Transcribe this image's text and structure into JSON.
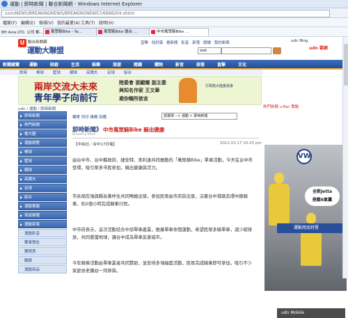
{
  "window": {
    "title": "運動 | 即時新聞 | 聯合新聞網 - Windows Internet Explorer"
  },
  "address": {
    "url": "com/NEWS/BREAKINGNEWS/BREAKINGNEWS7/6968204.shtml"
  },
  "menu": [
    "檔案(F)",
    "編輯(E)",
    "檢視(V)",
    "我的最愛(A)",
    "工具(T)",
    "說明(H)"
  ],
  "favorites": {
    "first": "BH Asia LTD. 公司 郵..."
  },
  "tabs": [
    {
      "label": "萬眾騎Bike - Ya..."
    },
    {
      "label": "萬眾騎Bike 環台 ..."
    },
    {
      "label": "中市萬眾騎Bike ..."
    }
  ],
  "site": {
    "brand_top": "聯合新聞網",
    "brand_main": "運動大聯盟",
    "toplinks": [
      "直擊",
      "找好康",
      "看新聞",
      "影音",
      "部落",
      "閱讀",
      "我的新聞"
    ],
    "right_links": "udn Blog",
    "udn_label": "udn 雲網",
    "search_scope": "web",
    "nav": [
      "新聞總覽",
      "運動",
      "財經",
      "生活",
      "娛樂",
      "旅遊",
      "閱讀",
      "購物",
      "影音",
      "部落",
      "直擊",
      "文化"
    ],
    "subnav": [
      "即時",
      "棒球",
      "籃球",
      "網球",
      "高爾夫",
      "足球",
      "綜合"
    ]
  },
  "banner": {
    "line1": "兩岸交流大未來",
    "line2": "青年學子向前行",
    "line3": "陸委會 張顯耀 副主委",
    "line4": "與知名作家 王文華",
    "line5": "邀你暢所欲言",
    "sponsor": "行政院大陸委員會"
  },
  "breadcrumb": "udn / 運動 / 即時新聞",
  "sidebar": [
    "即時新聞",
    "熱門新聞",
    "看大圖",
    "運動總覽",
    "棒球",
    "籃球",
    "網球",
    "高爾夫",
    "足球",
    "綜合",
    "運動專題",
    "球迷論壇",
    "運動部落",
    "運動影音",
    "賽事預告",
    "賽程表",
    "戰績",
    "運動商品",
    "健身",
    "單車"
  ],
  "article": {
    "tools": "轉寄  列印  推薦  回應",
    "select": "請選擇 --> 運動 > 即時新聞",
    "tag": "即時新聞》",
    "headline": "中市萬眾騎Bike 騎出健康",
    "breaking": "Breaking News",
    "source": "【中央社／台中17日電】",
    "date": "2012.03.17 10:15 pm",
    "paragraphs": [
      "由台中市、台中縣政府、捷安特、美利達共同推動的「萬眾騎Bike」單車活動，今天在台中市登場，吸引眾多市民參加，騎出健康與活力。",
      "市長胡志強與縣長黃仲生共同鳴槍出發，參加民眾由市府前出發，沿著台中港路及環中路騎乘，約2個小時完成騎乘行程。",
      "中市府表示，這次活動結合中部單車產業，推廣單車休閒運動，希望民眾多騎單車，減少碳排放，共同愛護地球，讓台中成為單車友善城市。",
      "今年騎乘活動由單車業者共同贊助，並安排多項抽獎活動，民眾完成騎乘即可參加，吸引不少家庭扶老攜幼一同參與。"
    ]
  },
  "right": {
    "tabs": "熱門新聞  u-Bar  專題",
    "ad_brand": "VW",
    "bubble_line1": "全新Jetta",
    "bubble_line2": "搭載6氣囊",
    "ad_label": "Das Auto.",
    "blue_ad": "運動用品特賣",
    "bottom_ad": "udn Mobile"
  }
}
